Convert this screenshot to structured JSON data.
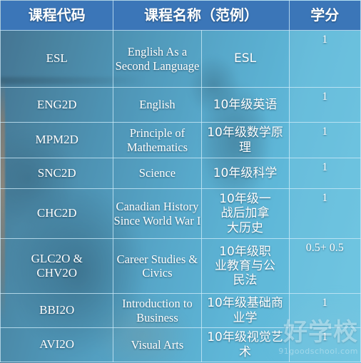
{
  "slide": {
    "title": "Grade 10 Course List Table",
    "colors": {
      "header_blue": "#3b76b8",
      "cell_cyan": "#5ab0d0",
      "background_deep_blue": "#2f4f6e",
      "border_white": "#cdeBf8",
      "text_white": "#ffffff"
    }
  },
  "table": {
    "headers": {
      "code": "课程代码",
      "name": "课程名称（范例）",
      "credit": "学分"
    },
    "rows": [
      {
        "code": "ESL",
        "name_en": "English As a Second Language",
        "name_cn": "ESL",
        "credit": "1"
      },
      {
        "code": "ENG2D",
        "name_en": "English",
        "name_cn": "10年级英语",
        "credit": "1"
      },
      {
        "code": "MPM2D",
        "name_en": "Principle of Mathematics",
        "name_cn": "10年级数学原理",
        "credit": "1"
      },
      {
        "code": "SNC2D",
        "name_en": "Science",
        "name_cn": "10年级科学",
        "credit": "1"
      },
      {
        "code": "CHC2D",
        "name_en": "Canadian History Since World War I",
        "name_cn": "10年级一战后加拿大历史",
        "credit": "1"
      },
      {
        "code": "GLC2O & CHV2O",
        "name_en": "Career Studies & Civics",
        "name_cn": "10年级职业教育与公民法",
        "credit": "0.5+ 0.5"
      },
      {
        "code": "BBI2O",
        "name_en": "Introduction to Business",
        "name_cn": "10年级基础商业学",
        "credit": "1"
      },
      {
        "code": "AVI2O",
        "name_en": "Visual Arts",
        "name_cn": "10年级视觉艺术",
        "credit": "1"
      }
    ]
  },
  "watermark": {
    "brand": "好学校",
    "url": "91goodschool.com"
  }
}
